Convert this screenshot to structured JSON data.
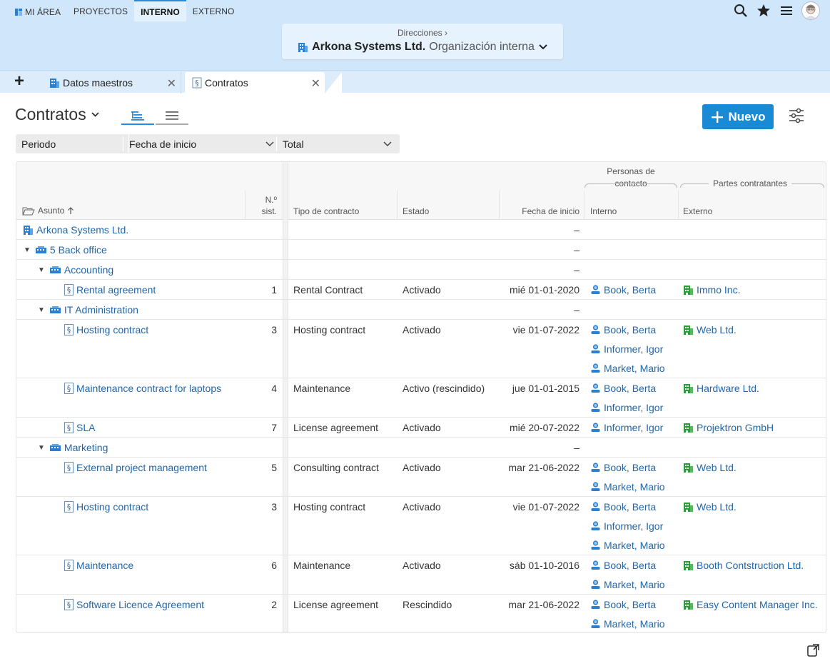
{
  "nav": {
    "items": [
      "MI ÁREA",
      "PROYECTOS",
      "INTERNO",
      "EXTERNO"
    ],
    "active": "INTERNO"
  },
  "context": {
    "breadcrumb": "Direcciones ›",
    "org_name": "Arkona Systems Ltd.",
    "org_type": "Organización interna"
  },
  "tabs": {
    "add_label": "+",
    "items": [
      "Datos maestros",
      "Contratos"
    ]
  },
  "page": {
    "title": "Contratos",
    "new_button": "Nuevo"
  },
  "filters": {
    "periodo": "Periodo",
    "fecha": "Fecha de inicio",
    "total": "Total"
  },
  "table": {
    "headers": {
      "asunto": "Asunto",
      "num1": "N.º",
      "num2": "sist.",
      "tipo": "Tipo de contracto",
      "estado": "Estado",
      "fecha": "Fecha de inicio",
      "grp_personas_1": "Personas de",
      "grp_personas_2": "contacto",
      "grp_partes": "Partes contratantes",
      "interno": "Interno",
      "externo": "Externo"
    },
    "rows": [
      {
        "kind": "org",
        "subject": "Arkona Systems Ltd.",
        "date": "–"
      },
      {
        "kind": "group1",
        "subject": "5 Back office",
        "date": "–"
      },
      {
        "kind": "group2",
        "subject": "Accounting",
        "date": "–"
      },
      {
        "kind": "contract",
        "subject": "Rental agreement",
        "num": "1",
        "tipo": "Rental Contract",
        "estado": "Activado",
        "date": "mié 01-01-2020",
        "interno": [
          "Book, Berta"
        ],
        "externo": "Immo Inc."
      },
      {
        "kind": "group2",
        "subject": "IT Administration",
        "date": "–"
      },
      {
        "kind": "contract",
        "subject": "Hosting contract",
        "num": "3",
        "tipo": "Hosting contract",
        "estado": "Activado",
        "date": "vie 01-07-2022",
        "interno": [
          "Book, Berta",
          "Informer, Igor",
          "Market, Mario"
        ],
        "externo": "Web Ltd."
      },
      {
        "kind": "contract",
        "subject": "Maintenance contract for laptops",
        "num": "4",
        "tipo": "Maintenance",
        "estado": "Activo (rescindido)",
        "date": "jue 01-01-2015",
        "interno": [
          "Book, Berta",
          "Informer, Igor"
        ],
        "externo": "Hardware Ltd."
      },
      {
        "kind": "contract",
        "subject": "SLA",
        "num": "7",
        "tipo": "License agreement",
        "estado": "Activado",
        "date": "mié 20-07-2022",
        "interno": [
          "Informer, Igor"
        ],
        "externo": "Projektron GmbH"
      },
      {
        "kind": "group2",
        "subject": "Marketing",
        "date": "–"
      },
      {
        "kind": "contract",
        "subject": "External project management",
        "num": "5",
        "tipo": "Consulting contract",
        "estado": "Activado",
        "date": "mar 21-06-2022",
        "interno": [
          "Book, Berta",
          "Market, Mario"
        ],
        "externo": "Web Ltd."
      },
      {
        "kind": "contract",
        "subject": "Hosting contract",
        "num": "3",
        "tipo": "Hosting contract",
        "estado": "Activado",
        "date": "vie 01-07-2022",
        "interno": [
          "Book, Berta",
          "Informer, Igor",
          "Market, Mario"
        ],
        "externo": "Web Ltd."
      },
      {
        "kind": "contract",
        "subject": "Maintenance",
        "num": "6",
        "tipo": "Maintenance",
        "estado": "Activado",
        "date": "sáb 01-10-2016",
        "interno": [
          "Book, Berta",
          "Market, Mario"
        ],
        "externo": "Booth Contstruction Ltd."
      },
      {
        "kind": "contract",
        "subject": "Software Licence Agreement",
        "num": "2",
        "tipo": "License agreement",
        "estado": "Rescindido",
        "date": "mar 21-06-2022",
        "interno": [
          "Book, Berta",
          "Market, Mario"
        ],
        "externo": "Easy Content Manager Inc."
      }
    ]
  },
  "colors": {
    "header_bg": "#cfe6fb",
    "accent": "#1a8ad5",
    "link": "#2266a8",
    "org_icon": "#2a7fd0",
    "company_icon": "#2e9a3a"
  }
}
